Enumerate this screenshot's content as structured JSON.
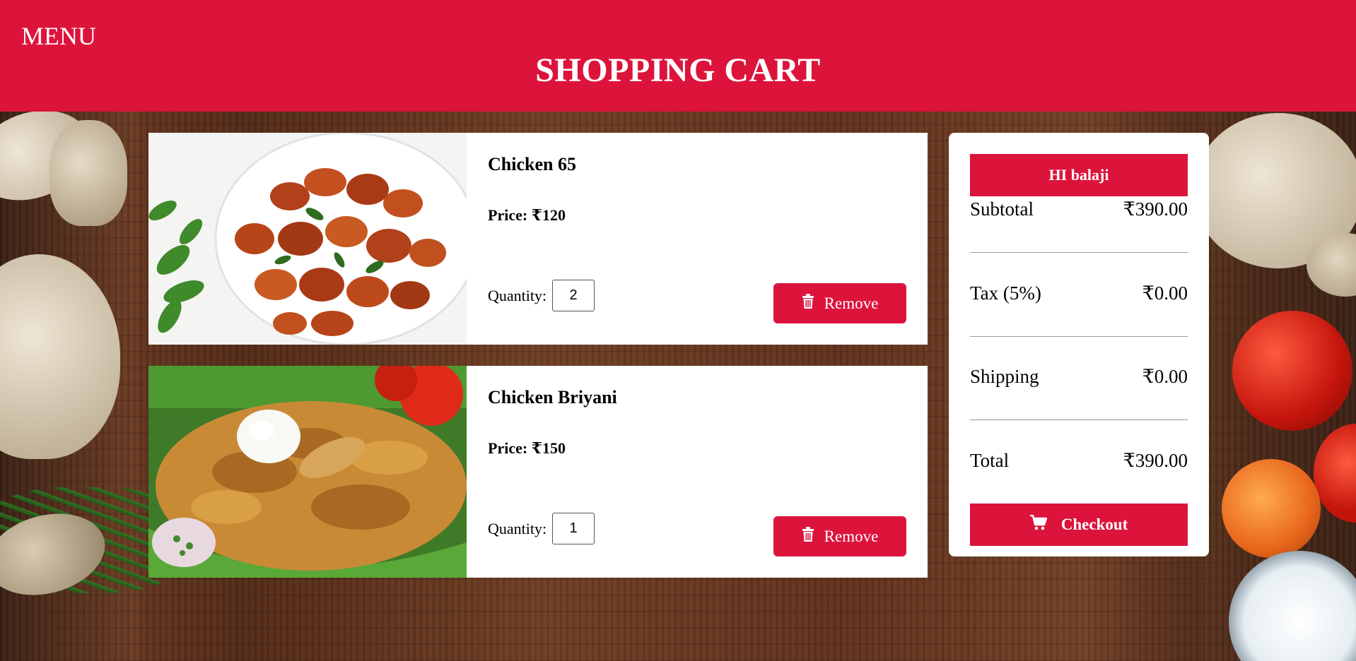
{
  "header": {
    "menu_label": "MENU",
    "title": "SHOPPING CART"
  },
  "cart": {
    "items": [
      {
        "name": "Chicken 65",
        "price": "Price: ₹120",
        "quantity_label": "Quantity:",
        "quantity": "2",
        "remove_label": "Remove",
        "image": "chicken-65-photo"
      },
      {
        "name": "Chicken Briyani",
        "price": "Price: ₹150",
        "quantity_label": "Quantity:",
        "quantity": "1",
        "remove_label": "Remove",
        "image": "chicken-biryani-photo"
      }
    ]
  },
  "summary": {
    "greeting": "HI balaji",
    "subtotal_label": "Subtotal",
    "subtotal_value": "₹390.00",
    "tax_label": "Tax (5%)",
    "tax_value": "₹0.00",
    "shipping_label": "Shipping",
    "shipping_value": "₹0.00",
    "total_label": "Total",
    "total_value": "₹390.00",
    "checkout_label": "Checkout"
  },
  "colors": {
    "brand": "#dc143c",
    "card": "#ffffff"
  },
  "icons": {
    "remove": "trash-icon",
    "checkout": "cart-icon"
  }
}
